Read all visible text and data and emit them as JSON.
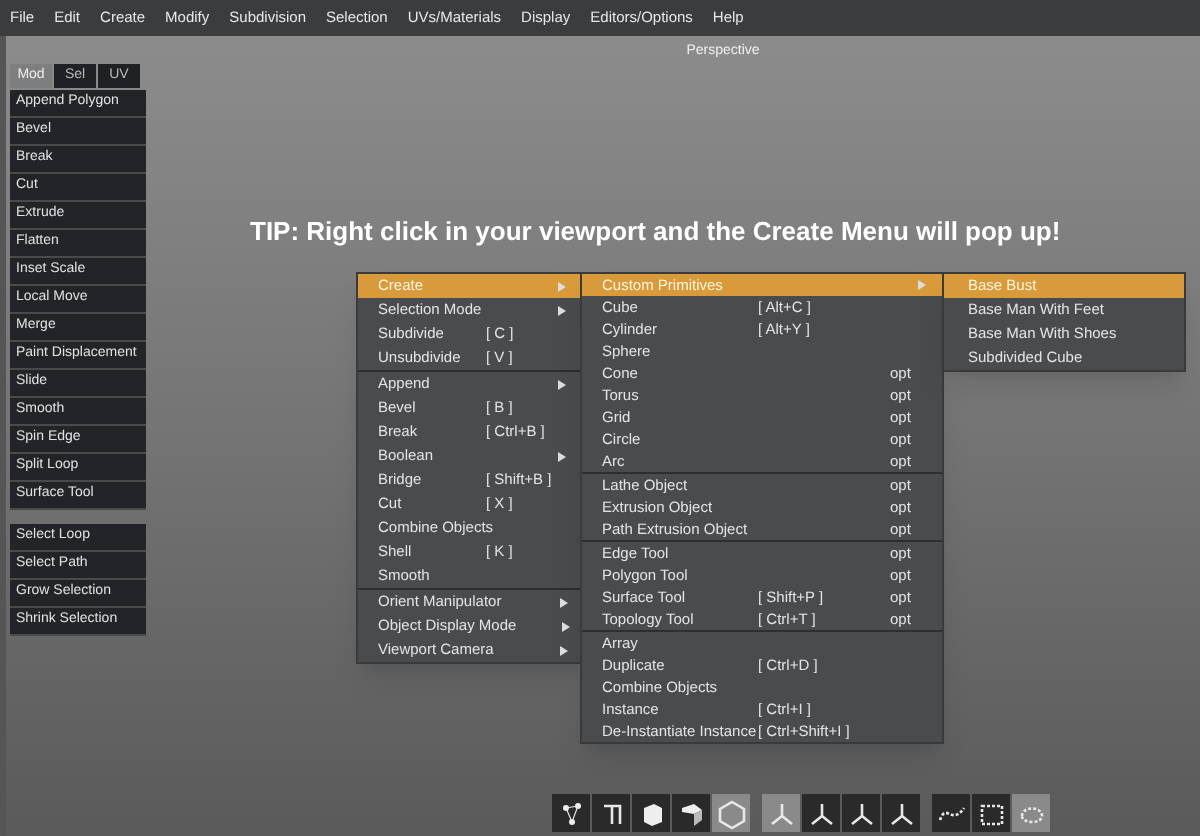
{
  "menubar": [
    "File",
    "Edit",
    "Create",
    "Modify",
    "Subdivision",
    "Selection",
    "UVs/Materials",
    "Display",
    "Editors/Options",
    "Help"
  ],
  "viewport": {
    "title": "Perspective",
    "tip": "TIP: Right click in your viewport and the Create Menu will pop up!"
  },
  "side_tabs": [
    {
      "label": "Mod",
      "selected": true
    },
    {
      "label": "Sel",
      "selected": false
    },
    {
      "label": "UV",
      "selected": false
    }
  ],
  "tool_groups": [
    [
      "Append Polygon",
      "Bevel",
      "Break",
      "Cut",
      "Extrude",
      "Flatten",
      "Inset Scale",
      "Local Move",
      "Merge",
      "Paint Displacement",
      "Slide",
      "Smooth",
      "Spin Edge",
      "Split Loop",
      "Surface Tool"
    ],
    [
      "Select Loop",
      "Select Path",
      "Grow Selection",
      "Shrink Selection"
    ]
  ],
  "context_menu": [
    [
      {
        "label": "Create",
        "submenu": true,
        "selected": true
      },
      {
        "label": "Selection Mode",
        "submenu": true,
        "selected": false
      },
      {
        "label": "Subdivide",
        "shortcut": "[ C ]",
        "submenu": false,
        "selected": false
      },
      {
        "label": "Unsubdivide",
        "shortcut": "[ V ]",
        "submenu": false,
        "selected": false
      }
    ],
    [
      {
        "label": "Append",
        "submenu": true,
        "selected": false
      },
      {
        "label": "Bevel",
        "shortcut": "[ B ]",
        "submenu": false,
        "selected": false
      },
      {
        "label": "Break",
        "shortcut": "[ Ctrl+B ]",
        "submenu": false,
        "selected": false
      },
      {
        "label": "Boolean",
        "submenu": true,
        "selected": false
      },
      {
        "label": "Bridge",
        "shortcut": "[ Shift+B ]",
        "submenu": false,
        "selected": false
      },
      {
        "label": "Cut",
        "shortcut": "[ X ]",
        "submenu": false,
        "selected": false
      },
      {
        "label": "Combine Objects",
        "submenu": false,
        "selected": false
      },
      {
        "label": "Shell",
        "shortcut": "[ K ]",
        "submenu": false,
        "selected": false
      },
      {
        "label": "Smooth",
        "submenu": false,
        "selected": false
      }
    ],
    [
      {
        "label": "Orient Manipulator",
        "submenu": true,
        "selected": false
      },
      {
        "label": "Object Display Mode",
        "submenu": true,
        "selected": false
      },
      {
        "label": "Viewport Camera",
        "submenu": true,
        "selected": false
      }
    ]
  ],
  "create_menu": [
    [
      {
        "label": "Custom Primitives",
        "submenu": true,
        "selected": true
      },
      {
        "label": "Cube",
        "shortcut": "[ Alt+C ]",
        "submenu": false,
        "selected": false
      },
      {
        "label": "Cylinder",
        "shortcut": "[ Alt+Y ]",
        "submenu": false,
        "selected": false
      },
      {
        "label": "Sphere",
        "submenu": false,
        "selected": false
      },
      {
        "label": "Cone",
        "option": "opt",
        "submenu": false,
        "selected": false
      },
      {
        "label": "Torus",
        "option": "opt",
        "submenu": false,
        "selected": false
      },
      {
        "label": "Grid",
        "option": "opt",
        "submenu": false,
        "selected": false
      },
      {
        "label": "Circle",
        "option": "opt",
        "submenu": false,
        "selected": false
      },
      {
        "label": "Arc",
        "option": "opt",
        "submenu": false,
        "selected": false
      }
    ],
    [
      {
        "label": "Lathe Object",
        "option": "opt",
        "submenu": false,
        "selected": false
      },
      {
        "label": "Extrusion Object",
        "option": "opt",
        "submenu": false,
        "selected": false
      },
      {
        "label": "Path Extrusion Object",
        "option": "opt",
        "submenu": false,
        "selected": false
      }
    ],
    [
      {
        "label": "Edge Tool",
        "option": "opt",
        "submenu": false,
        "selected": false
      },
      {
        "label": "Polygon Tool",
        "option": "opt",
        "submenu": false,
        "selected": false
      },
      {
        "label": "Surface Tool",
        "shortcut": "[ Shift+P ]",
        "option": "opt",
        "submenu": false,
        "selected": false
      },
      {
        "label": "Topology Tool",
        "shortcut": "[ Ctrl+T ]",
        "option": "opt",
        "submenu": false,
        "selected": false
      }
    ],
    [
      {
        "label": "Array",
        "submenu": false,
        "selected": false
      },
      {
        "label": "Duplicate",
        "shortcut": "[ Ctrl+D ]",
        "submenu": false,
        "selected": false
      },
      {
        "label": "Combine Objects",
        "submenu": false,
        "selected": false
      },
      {
        "label": "Instance",
        "shortcut": "[ Ctrl+I ]",
        "submenu": false,
        "selected": false
      },
      {
        "label": "De-Instantiate Instance",
        "shortcut": "[ Ctrl+Shift+I ]",
        "submenu": false,
        "selected": false
      }
    ]
  ],
  "primitives_menu": [
    {
      "label": "Base Bust",
      "selected": true
    },
    {
      "label": "Base Man With Feet",
      "selected": false
    },
    {
      "label": "Base Man With Shoes",
      "selected": false
    },
    {
      "label": "Subdivided Cube",
      "selected": false
    }
  ],
  "toolbar": [
    [
      {
        "kind": "vertex",
        "selected": false
      },
      {
        "kind": "edge",
        "selected": false
      },
      {
        "kind": "face",
        "selected": false
      },
      {
        "kind": "object",
        "selected": false
      },
      {
        "kind": "hexagon",
        "selected": true
      }
    ],
    [
      {
        "kind": "axes",
        "selected": true
      },
      {
        "kind": "axes",
        "selected": false
      },
      {
        "kind": "axes",
        "selected": false
      },
      {
        "kind": "axes",
        "selected": false
      }
    ],
    [
      {
        "kind": "curve",
        "selected": false
      },
      {
        "kind": "rect",
        "selected": false
      },
      {
        "kind": "blob",
        "selected": true
      }
    ]
  ]
}
